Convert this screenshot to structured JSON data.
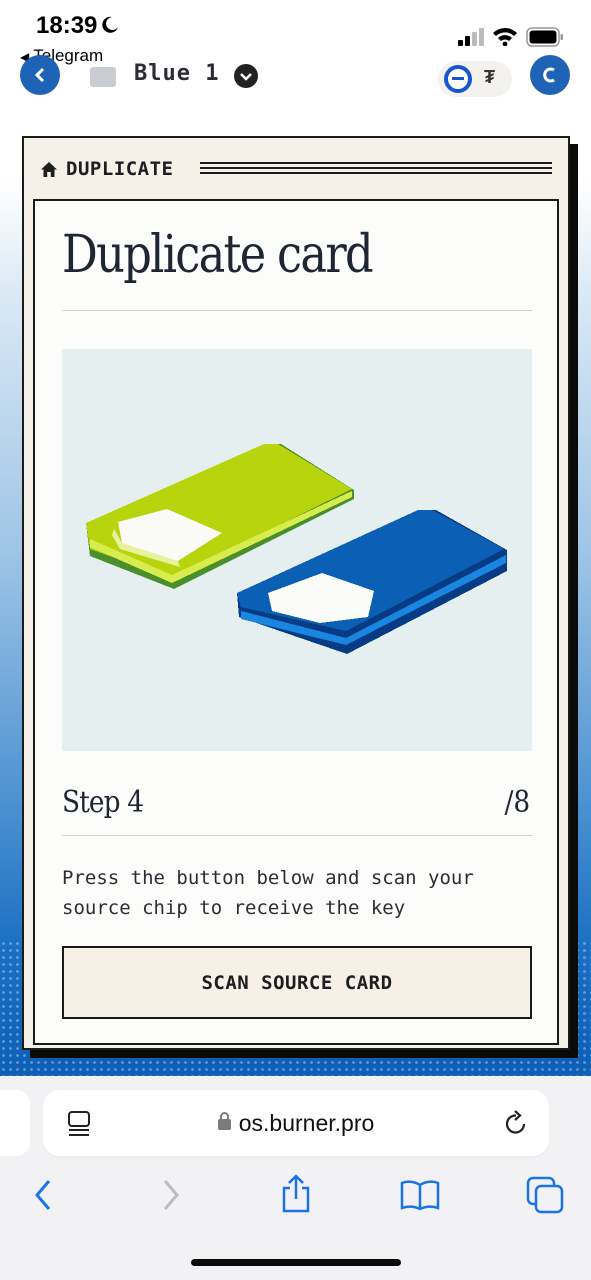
{
  "status_bar": {
    "time": "18:39",
    "back_app": "Telegram"
  },
  "app_header": {
    "title": "Blue 1"
  },
  "card": {
    "breadcrumb": "DUPLICATE",
    "title": "Duplicate card",
    "step_label": "Step 4",
    "step_total": "/8",
    "description": "Press the button below and scan your source chip to receive the key",
    "button_label": "SCAN SOURCE CARD"
  },
  "browser": {
    "url": "os.burner.pro"
  },
  "colors": {
    "accent_blue": "#1f63b6",
    "card_bg": "#f5f0e8",
    "green_card": "#b7d40c",
    "blue_card": "#0b5fb5",
    "illustration_bg": "#e5efef"
  },
  "icons": [
    "moon-icon",
    "signal-icon",
    "wifi-icon",
    "battery-icon",
    "home-icon",
    "lock-icon",
    "tabs-icon",
    "reload-icon",
    "back-icon",
    "forward-icon",
    "share-icon",
    "bookmarks-icon",
    "tab-overview-icon"
  ]
}
